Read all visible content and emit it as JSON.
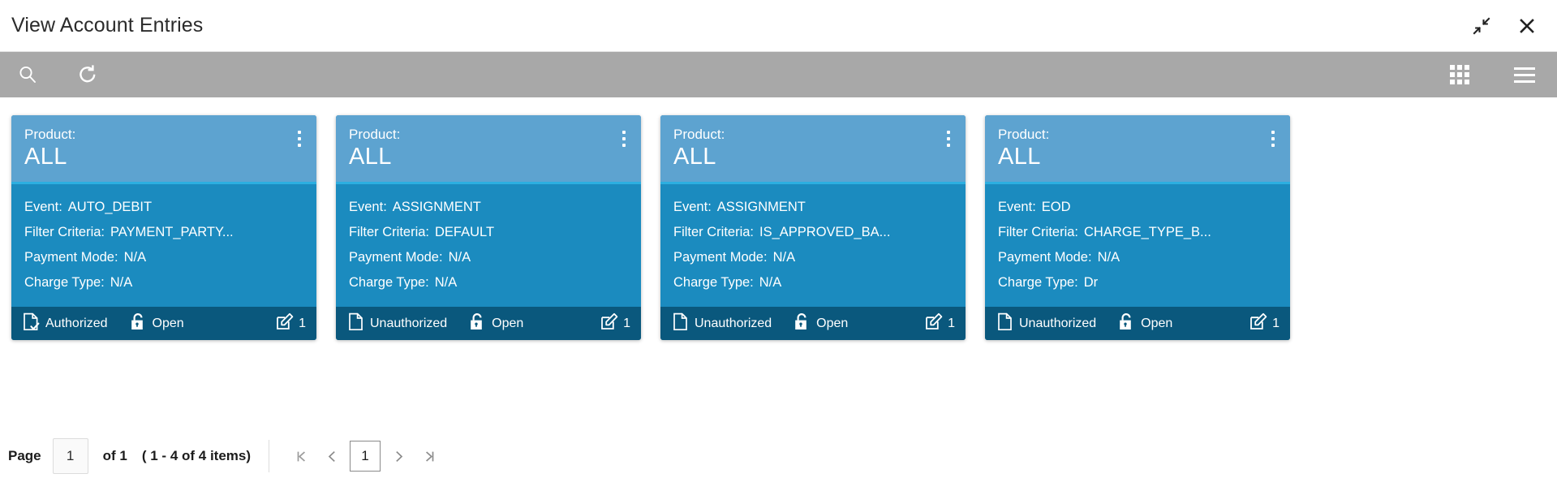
{
  "window": {
    "title": "View Account Entries",
    "collapse_icon": "collapse-arrows-icon",
    "close_icon": "close-icon"
  },
  "toolbar": {
    "search_icon": "search-icon",
    "refresh_icon": "refresh-icon",
    "grid_view_icon": "grid-view-icon",
    "menu_icon": "hamburger-menu-icon"
  },
  "cards": [
    {
      "header_label": "Product:",
      "header_value": "ALL",
      "menu_icon": "kebab-menu-icon",
      "rows": [
        {
          "key": "Event:",
          "value": "AUTO_DEBIT"
        },
        {
          "key": "Filter Criteria:",
          "value": "PAYMENT_PARTY..."
        },
        {
          "key": "Payment Mode:",
          "value": "N/A"
        },
        {
          "key": "Charge Type:",
          "value": "N/A"
        }
      ],
      "footer": {
        "auth_status": "Authorized",
        "auth_icon": "document-check-icon",
        "lock_status": "Open",
        "lock_icon": "unlock-icon",
        "edit_count": "1",
        "edit_icon": "edit-square-icon"
      }
    },
    {
      "header_label": "Product:",
      "header_value": "ALL",
      "menu_icon": "kebab-menu-icon",
      "rows": [
        {
          "key": "Event:",
          "value": "ASSIGNMENT"
        },
        {
          "key": "Filter Criteria:",
          "value": "DEFAULT"
        },
        {
          "key": "Payment Mode:",
          "value": "N/A"
        },
        {
          "key": "Charge Type:",
          "value": "N/A"
        }
      ],
      "footer": {
        "auth_status": "Unauthorized",
        "auth_icon": "document-icon",
        "lock_status": "Open",
        "lock_icon": "unlock-icon",
        "edit_count": "1",
        "edit_icon": "edit-square-icon"
      }
    },
    {
      "header_label": "Product:",
      "header_value": "ALL",
      "menu_icon": "kebab-menu-icon",
      "rows": [
        {
          "key": "Event:",
          "value": "ASSIGNMENT"
        },
        {
          "key": "Filter Criteria:",
          "value": "IS_APPROVED_BA..."
        },
        {
          "key": "Payment Mode:",
          "value": "N/A"
        },
        {
          "key": "Charge Type:",
          "value": "N/A"
        }
      ],
      "footer": {
        "auth_status": "Unauthorized",
        "auth_icon": "document-icon",
        "lock_status": "Open",
        "lock_icon": "unlock-icon",
        "edit_count": "1",
        "edit_icon": "edit-square-icon"
      }
    },
    {
      "header_label": "Product:",
      "header_value": "ALL",
      "menu_icon": "kebab-menu-icon",
      "rows": [
        {
          "key": "Event:",
          "value": "EOD"
        },
        {
          "key": "Filter Criteria:",
          "value": "CHARGE_TYPE_B..."
        },
        {
          "key": "Payment Mode:",
          "value": "N/A"
        },
        {
          "key": "Charge Type:",
          "value": "Dr"
        }
      ],
      "footer": {
        "auth_status": "Unauthorized",
        "auth_icon": "document-icon",
        "lock_status": "Open",
        "lock_icon": "unlock-icon",
        "edit_count": "1",
        "edit_icon": "edit-square-icon"
      }
    }
  ],
  "pagination": {
    "page_label": "Page",
    "page_value": "1",
    "of_text": "of 1",
    "items_text": "( 1 - 4 of 4 items)",
    "first_icon": "first-page-icon",
    "prev_icon": "prev-page-icon",
    "current_page": "1",
    "next_icon": "next-page-icon",
    "last_icon": "last-page-icon"
  },
  "colors": {
    "card_header": "#5da3d0",
    "card_body": "#1b8bbf",
    "card_footer": "#0a587d",
    "card_divider": "#2cafe0",
    "toolbar": "#a8a8a8"
  }
}
